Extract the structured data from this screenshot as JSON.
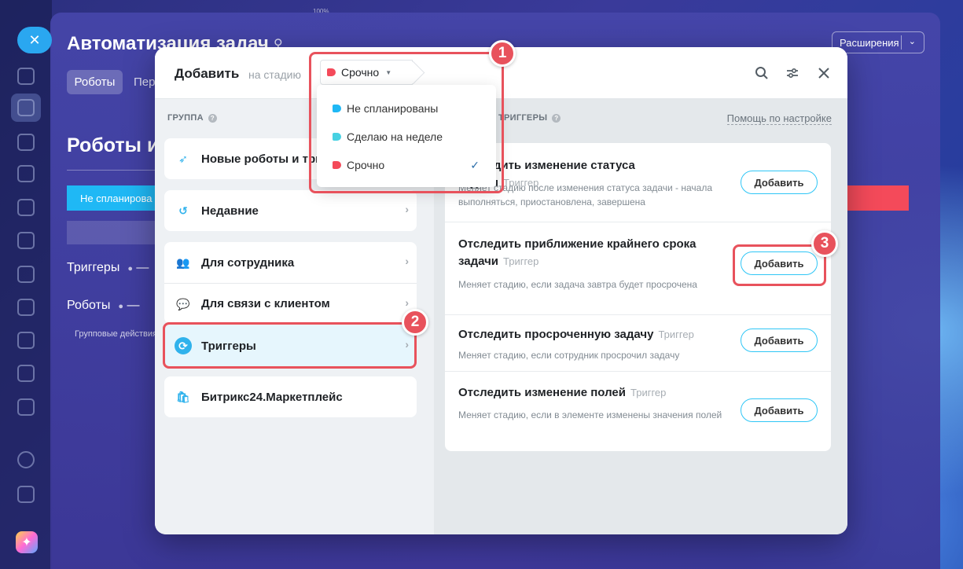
{
  "background": {
    "page_title": "Автоматизация задач",
    "tabs": [
      "Роботы",
      "Пер"
    ],
    "extensions_label": "Расширения",
    "section_title": "Роботы и",
    "stage_label": "Не спланирова",
    "triggers_label": "Триггеры",
    "robots_label": "Роботы",
    "group_actions": "Групповые действия",
    "top_percent": "100%"
  },
  "modal": {
    "title": "Добавить",
    "subtitle": "на стадию",
    "selected_stage": "Срочно",
    "selected_stage_color": "#f44a5a",
    "icons": [
      "search-icon",
      "filter-icon",
      "close-icon"
    ]
  },
  "dropdown": {
    "options": [
      {
        "label": "Не спланированы",
        "color": "#1fb8f5"
      },
      {
        "label": "Сделаю на неделе",
        "color": "#47d1e2"
      },
      {
        "label": "Срочно",
        "color": "#f44a5a",
        "selected": true
      }
    ]
  },
  "groups": {
    "header": "ГРУППА",
    "items": [
      {
        "label": "Новые роботы и три",
        "icon": "rocket-icon"
      },
      {
        "label": "Недавние",
        "icon": "history-icon"
      },
      {
        "label": "Для сотрудника",
        "icon": "users-icon"
      },
      {
        "label": "Для связи с клиентом",
        "icon": "chat-icon"
      },
      {
        "label": "Триггеры",
        "icon": "trigger-icon",
        "selected": true
      },
      {
        "label": "Битрикс24.Маркетплейс",
        "icon": "marketplace-icon"
      }
    ]
  },
  "triggers": {
    "header": "ТРИГГЕРЫ",
    "help_link": "Помощь по настройке",
    "items": [
      {
        "title": "Отследить изменение статуса задачи",
        "kind": "Триггер",
        "desc": "Меняет стадию после изменения статуса задачи - начала выполняться, приостановлена, завершена",
        "button": "Добавить"
      },
      {
        "title": "Отследить приближение крайнего срока задачи",
        "kind": "Триггер",
        "desc": "Меняет стадию, если задача завтра будет просрочена",
        "button": "Добавить"
      },
      {
        "title": "Отследить просроченную задачу",
        "kind": "Триггер",
        "desc": "Меняет стадию, если сотрудник просрочил задачу",
        "button": "Добавить"
      },
      {
        "title": "Отследить изменение полей",
        "kind": "Триггер",
        "desc": "Меняет стадию, если в элементе изменены значения полей",
        "button": "Добавить"
      }
    ]
  },
  "callouts": [
    "1",
    "2",
    "3"
  ]
}
